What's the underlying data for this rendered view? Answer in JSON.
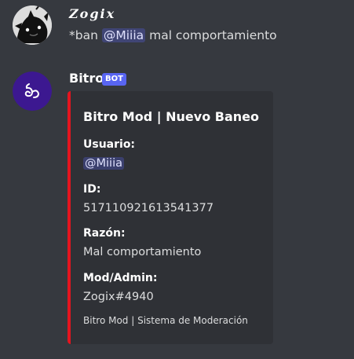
{
  "messages": [
    {
      "author": "Zogix",
      "command": "*ban",
      "mention": "@Miiia",
      "text": "mal comportamiento"
    },
    {
      "author": "Bitro",
      "bot_tag": "BOT",
      "embed": {
        "accent_color": "#e5141f",
        "title": "Bitro Mod | Nuevo Baneo",
        "fields": [
          {
            "name": "Usuario:",
            "value": "@Miiia"
          },
          {
            "name": "ID:",
            "value": "517110921613541377"
          },
          {
            "name": "Razón:",
            "value": "Mal comportamiento"
          },
          {
            "name": "Mod/Admin:",
            "value": "Zogix#4940"
          }
        ],
        "footer": "Bitro Mod | Sistema de Moderación"
      }
    }
  ],
  "colors": {
    "background": "#36393f",
    "embed_background": "#2f3136",
    "bot_tag": "#5865f2",
    "bitro_avatar": "#3c1890"
  },
  "icons": {
    "zogix_avatar": "black-cartoon-creature-avatar",
    "bitro_avatar": "bitro-logo-avatar"
  }
}
